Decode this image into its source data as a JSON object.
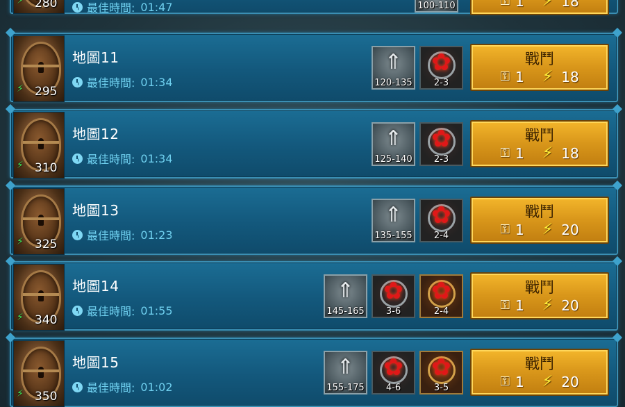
{
  "labels": {
    "best_time": "最佳時間:",
    "fight": "戰鬥"
  },
  "icons": {
    "level": "level-chevron-icon",
    "enemy_red": "red-flower-enemy-icon",
    "enemy_gold": "gold-flower-enemy-icon",
    "key": "key-icon",
    "bolt": "lightning-bolt-icon",
    "clock": "clock-icon"
  },
  "colors": {
    "row_bg": "#1b6d94",
    "time_text": "#6fd0ef",
    "power_bolt": "#3fe85a",
    "fight_button": "#e0a020"
  },
  "partial_row": {
    "power": "280",
    "time": "01:47",
    "level_range": "100-110",
    "key_cost": "1",
    "energy_cost": "18"
  },
  "maps": [
    {
      "name": "地圖11",
      "power": "295",
      "time": "01:34",
      "level_range": "120-135",
      "enemies": [
        {
          "kind": "red",
          "count": "2-3"
        }
      ],
      "key_cost": "1",
      "energy_cost": "18"
    },
    {
      "name": "地圖12",
      "power": "310",
      "time": "01:34",
      "level_range": "125-140",
      "enemies": [
        {
          "kind": "red",
          "count": "2-3"
        }
      ],
      "key_cost": "1",
      "energy_cost": "18"
    },
    {
      "name": "地圖13",
      "power": "325",
      "time": "01:23",
      "level_range": "135-155",
      "enemies": [
        {
          "kind": "red",
          "count": "2-4"
        }
      ],
      "key_cost": "1",
      "energy_cost": "20"
    },
    {
      "name": "地圖14",
      "power": "340",
      "time": "01:55",
      "level_range": "145-165",
      "enemies": [
        {
          "kind": "red",
          "count": "3-6"
        },
        {
          "kind": "gold",
          "count": "2-4"
        }
      ],
      "key_cost": "1",
      "energy_cost": "20"
    },
    {
      "name": "地圖15",
      "power": "350",
      "time": "01:02",
      "level_range": "155-175",
      "enemies": [
        {
          "kind": "red",
          "count": "4-6"
        },
        {
          "kind": "gold",
          "count": "3-5"
        }
      ],
      "key_cost": "1",
      "energy_cost": "20"
    }
  ]
}
